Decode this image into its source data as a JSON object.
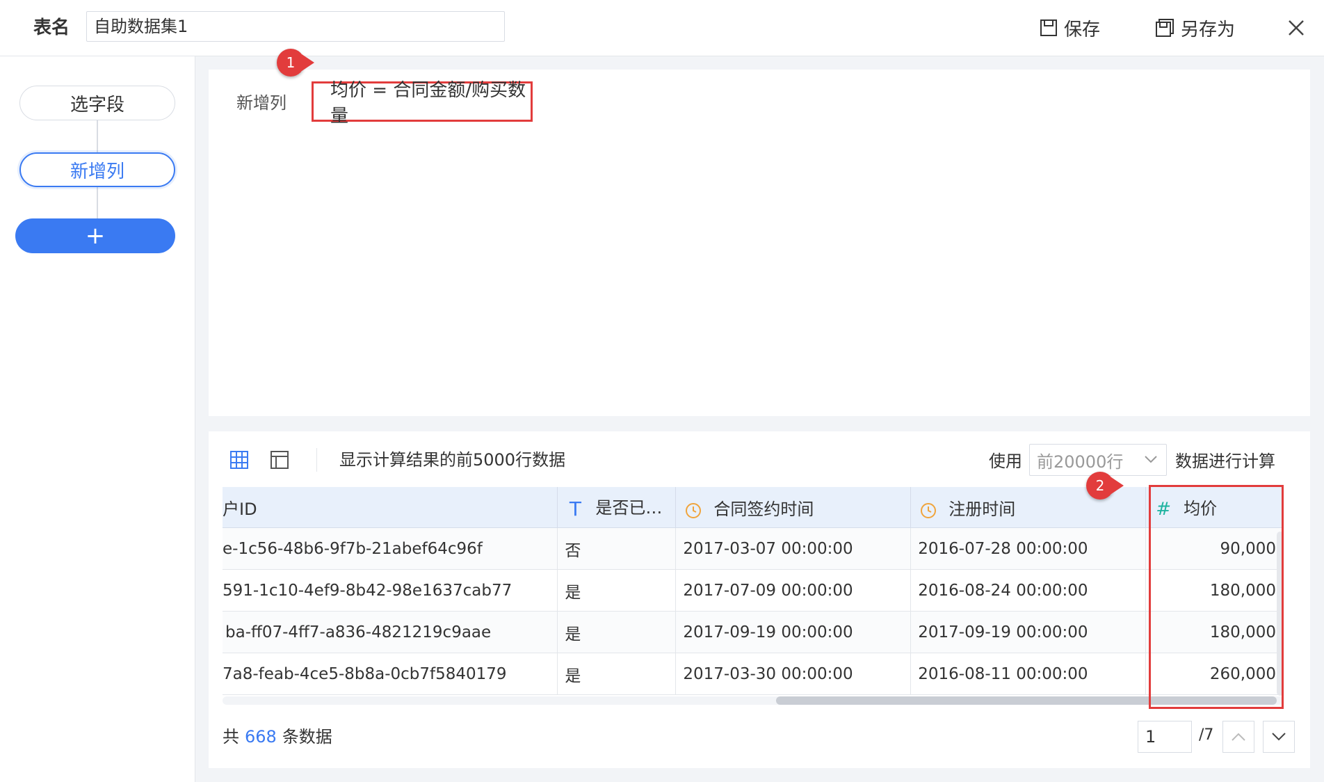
{
  "header": {
    "title_label": "表名",
    "title_value": "自助数据集1",
    "save_label": "保存",
    "saveas_label": "另存为"
  },
  "sidebar": {
    "steps": [
      {
        "label": "选字段"
      },
      {
        "label": "新增列"
      },
      {
        "label": "+"
      }
    ]
  },
  "formula": {
    "label": "新增列",
    "expression": "均价 = 合同金额/购买数量"
  },
  "callouts": [
    "1",
    "2"
  ],
  "toolbar": {
    "preview_text": "显示计算结果的前5000行数据",
    "use_label": "使用",
    "rows_select": "前20000行",
    "calc_label": "数据进行计算"
  },
  "table": {
    "columns": [
      {
        "label": "户ID",
        "icon": ""
      },
      {
        "label": "是否已…",
        "icon": "text-type-icon"
      },
      {
        "label": "合同签约时间",
        "icon": "clock-icon"
      },
      {
        "label": "注册时间",
        "icon": "clock-icon"
      },
      {
        "label": "均价",
        "icon": "number-type-icon"
      }
    ],
    "rows": [
      [
        "e-1c56-48b6-9f7b-21abef64c96f",
        "否",
        "2017-03-07 00:00:00",
        "2016-07-28 00:00:00",
        "90,000"
      ],
      [
        "591-1c10-4ef9-8b42-98e1637cab77",
        "是",
        "2017-07-09 00:00:00",
        "2016-08-24 00:00:00",
        "180,000"
      ],
      [
        "ba-ff07-4ff7-a836-4821219c9aae",
        "是",
        "2017-09-19 00:00:00",
        "2017-09-19 00:00:00",
        "180,000"
      ],
      [
        "7a8-feab-4ce5-8b8a-0cb7f5840179",
        "是",
        "2017-03-30 00:00:00",
        "2016-08-11 00:00:00",
        "260,000"
      ]
    ]
  },
  "footer": {
    "total_prefix": "共",
    "total_count": "668",
    "total_suffix": "条数据",
    "page_current": "1",
    "page_total": "/7"
  },
  "colors": {
    "accent": "#3a7af2",
    "highlight": "#e23c3c",
    "header_bg": "#e8f0fb",
    "clock": "#f0a43c",
    "number_icon": "#1fb3a0"
  }
}
